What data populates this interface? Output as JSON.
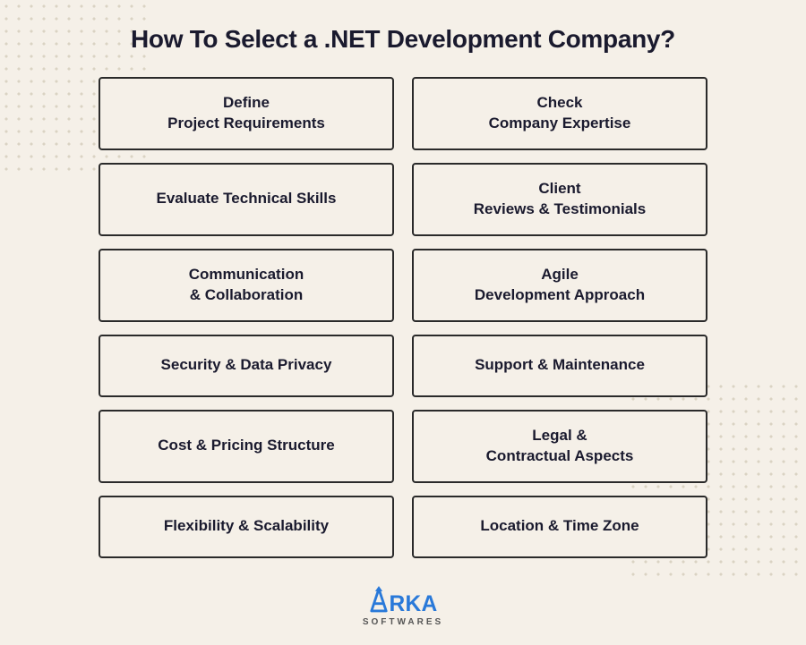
{
  "page": {
    "title": "How To Select a .NET Development Company?",
    "background_color": "#f5f0e8"
  },
  "cards": [
    {
      "id": "define-project",
      "text": "Define\nProject Requirements",
      "col": 1
    },
    {
      "id": "check-expertise",
      "text": "Check\nCompany Expertise",
      "col": 2
    },
    {
      "id": "evaluate-skills",
      "text": "Evaluate Technical Skills",
      "col": 1
    },
    {
      "id": "client-reviews",
      "text": "Client\nReviews & Testimonials",
      "col": 2
    },
    {
      "id": "communication",
      "text": "Communication\n& Collaboration",
      "col": 1
    },
    {
      "id": "agile-approach",
      "text": "Agile\nDevelopment Approach",
      "col": 2
    },
    {
      "id": "security-privacy",
      "text": "Security & Data Privacy",
      "col": 1
    },
    {
      "id": "support-maintenance",
      "text": "Support  & Maintenance",
      "col": 2
    },
    {
      "id": "cost-pricing",
      "text": "Cost & Pricing Structure",
      "col": 1
    },
    {
      "id": "legal-contractual",
      "text": "Legal &\nContractual Aspects",
      "col": 2
    },
    {
      "id": "flexibility-scalability",
      "text": "Flexibility & Scalability",
      "col": 1
    },
    {
      "id": "location-timezone",
      "text": "Location & Time Zone",
      "col": 2
    }
  ],
  "logo": {
    "tagline": "SOFTWARES"
  }
}
